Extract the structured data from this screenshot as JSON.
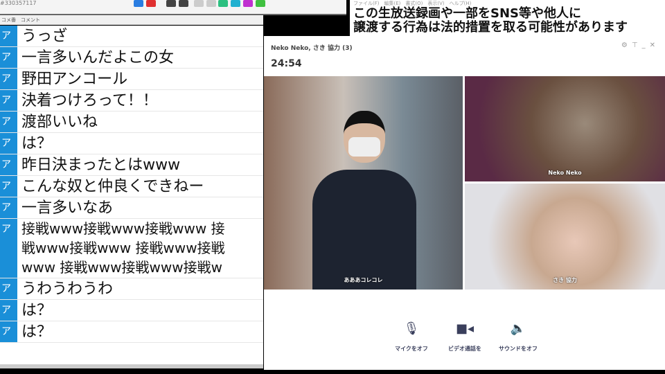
{
  "toolbar": {
    "id_text": "#330357117"
  },
  "list": {
    "col_no": "コメ番",
    "col_comment": "コメント",
    "marker": "ア",
    "comments": [
      "うっざ",
      "一言多いんだよこの女",
      "野田アンコール",
      "決着つけろって！！",
      "渡部いいね",
      "は？",
      "昨日決まったとはwww",
      "こんな奴と仲良くできねー",
      "一言多いなあ"
    ],
    "multi": [
      "接戦www接戦www接戦www 接",
      "戦www接戦www 接戦www接戦",
      "www 接戦www接戦www接戦w"
    ],
    "comments2": [
      "うわうわうわ",
      "は？",
      "は？"
    ]
  },
  "menu": "ファイル(F)　編集(E)　書式(O)　表示(V)　ヘルプ(H)",
  "notice": {
    "line1": "この生放送録画や一部をSNS等や他人に",
    "line2": "譲渡する行為は法的措置を取る可能性があります"
  },
  "call": {
    "title": "Neko Neko, さき 協力 (3)",
    "timer": "24:54",
    "participants": [
      "あああコレコレ",
      "Neko Neko",
      "さき 協力"
    ],
    "controls": [
      "マイクをオフ",
      "ビデオ通話を",
      "サウンドをオフ"
    ]
  }
}
